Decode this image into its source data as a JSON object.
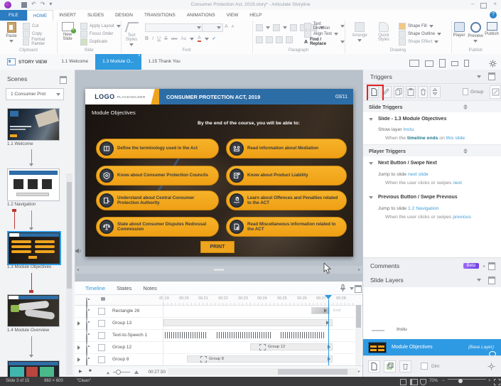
{
  "glyphs": {
    "caret_down": "▾",
    "caret_right": "▸",
    "close": "×",
    "minimize": "–",
    "help": "?",
    "play": "▶",
    "stop": "■",
    "plus": "+",
    "minus": "−",
    "undo": "↶",
    "redo": "↷",
    "left": "◂",
    "right": "▸"
  },
  "titlebar": {
    "title": "Consumer Protection Act, 2019.story* - Articulate Storyline"
  },
  "ribbon": {
    "tabs": [
      "FILE",
      "HOME",
      "INSERT",
      "SLIDES",
      "DESIGN",
      "TRANSITIONS",
      "ANIMATIONS",
      "VIEW",
      "HELP"
    ],
    "active_tab": "HOME",
    "clipboard": {
      "label": "Clipboard",
      "paste": "Paste",
      "cut": "Cut",
      "copy": "Copy",
      "format_painter": "Format Painter"
    },
    "slide": {
      "label": "Slide",
      "new_slide": "New Slide",
      "apply_layout": "Apply Layout",
      "focus_order": "Focus Order",
      "duplicate": "Duplicate"
    },
    "font": {
      "label": "Font",
      "text_styles": "Text Styles",
      "bold": "B",
      "italic": "I",
      "underline": "U",
      "strike": "S",
      "abc": "abc",
      "aa": "Aa",
      "color": "A"
    },
    "paragraph": {
      "label": "Paragraph",
      "text_direction": "Text Direction",
      "align_text": "Align Text",
      "find_replace": "Find / Replace"
    },
    "drawing": {
      "label": "Drawing",
      "arrange": "Arrange",
      "quick_styles": "Quick Styles",
      "shape_fill": "Shape Fill",
      "shape_outline": "Shape Outline",
      "shape_effect": "Shape Effect"
    },
    "publish": {
      "label": "Publish",
      "player": "Player",
      "preview": "Preview",
      "publish": "Publish"
    }
  },
  "tabstrip": {
    "story_view": "STORY VIEW",
    "tabs": [
      {
        "label": "1.1 Welcome"
      },
      {
        "label": "1.3 Module O..."
      },
      {
        "label": "1.15 Thank You"
      }
    ]
  },
  "scenes": {
    "header": "Scenes",
    "selector": "1 Consumer Prot",
    "slides": [
      {
        "label": "1.1 Welcome"
      },
      {
        "label": "1.2 Navigation"
      },
      {
        "label": "1.3 Module Objectives"
      },
      {
        "label": "1.4 Module Overview"
      }
    ]
  },
  "slide": {
    "logo_main": "LOGO",
    "logo_sub": "PLACEHOLDER",
    "header_title": "CONSUMER PROTECTION ACT, 2019",
    "page_indicator": "03/11",
    "title": "Module Objectives",
    "intro": "By the end of the course, you will be able to:",
    "pills": [
      {
        "icon": "terminology-icon",
        "text": "Define the terminology used in the Act"
      },
      {
        "icon": "mediation-icon",
        "text": "Read information about Mediation"
      },
      {
        "icon": "councils-icon",
        "text": "Know about Consumer Protection Councils"
      },
      {
        "icon": "product-liability-icon",
        "text": "Know about Product Liability"
      },
      {
        "icon": "authority-icon",
        "text": "Understand about Central Consumer Protection Authority"
      },
      {
        "icon": "offences-icon",
        "text": "Learn about Offences and Penalties related to the ACT"
      },
      {
        "icon": "disputes-icon",
        "text": "State about Consumer Disputes Redressal Commission"
      },
      {
        "icon": "miscellaneous-icon",
        "text": "Read Miscellaneous information related to the ACT"
      }
    ],
    "print_button": "PRINT"
  },
  "timeline": {
    "tabs": [
      "Timeline",
      "States",
      "Notes"
    ],
    "active_tab": "Timeline",
    "ruler": [
      "00:19",
      "00:20",
      "00:21",
      "00:22",
      "00:23",
      "00:24",
      "00:25",
      "00:26",
      "00:27",
      "00:28"
    ],
    "rows": [
      {
        "name": "Rectangle 26"
      },
      {
        "name": "Group 13"
      },
      {
        "name": "Text-to-Speech 1"
      },
      {
        "name": "Group 12",
        "bar_label": "Group 12"
      },
      {
        "name": "Group 8",
        "bar_label": "Group 8"
      }
    ],
    "end_marker": "End",
    "current_time": "00:27.50"
  },
  "triggers": {
    "header": "Triggers",
    "group_label": "Group",
    "slide_triggers": {
      "header": "Slide Triggers",
      "group_title": "Slide - 1.3 Module Objectives",
      "action_prefix": "Show layer ",
      "action_link": "Instu",
      "when_prefix": "When the ",
      "when_bold": "timeline ends",
      "when_mid": " on ",
      "when_link": "this slide"
    },
    "player_triggers": {
      "header": "Player Triggers",
      "next": {
        "title": "Next Button / Swipe Next",
        "action_prefix": "Jump to slide ",
        "action_link": "next slide",
        "when_prefix": "When the user clicks or swipes ",
        "when_link": "next"
      },
      "previous": {
        "title": "Previous Button / Swipe Previous",
        "action_prefix": "Jump to slide ",
        "action_link": "1.2 Navigation",
        "when_prefix": "When the user clicks or swipes ",
        "when_link": "previous"
      }
    }
  },
  "comments": {
    "header": "Comments",
    "badge": "Beta"
  },
  "slide_layers": {
    "header": "Slide Layers",
    "layers": [
      {
        "name": "Instu"
      },
      {
        "name": "Module Objectives",
        "suffix": "(Base Layer)"
      }
    ],
    "dim_label": "Dim"
  },
  "statusbar": {
    "slide_info": "Slide 3 of 15",
    "dimensions": "960 × 600",
    "theme": "\"Clean\"",
    "zoom": "70%"
  }
}
